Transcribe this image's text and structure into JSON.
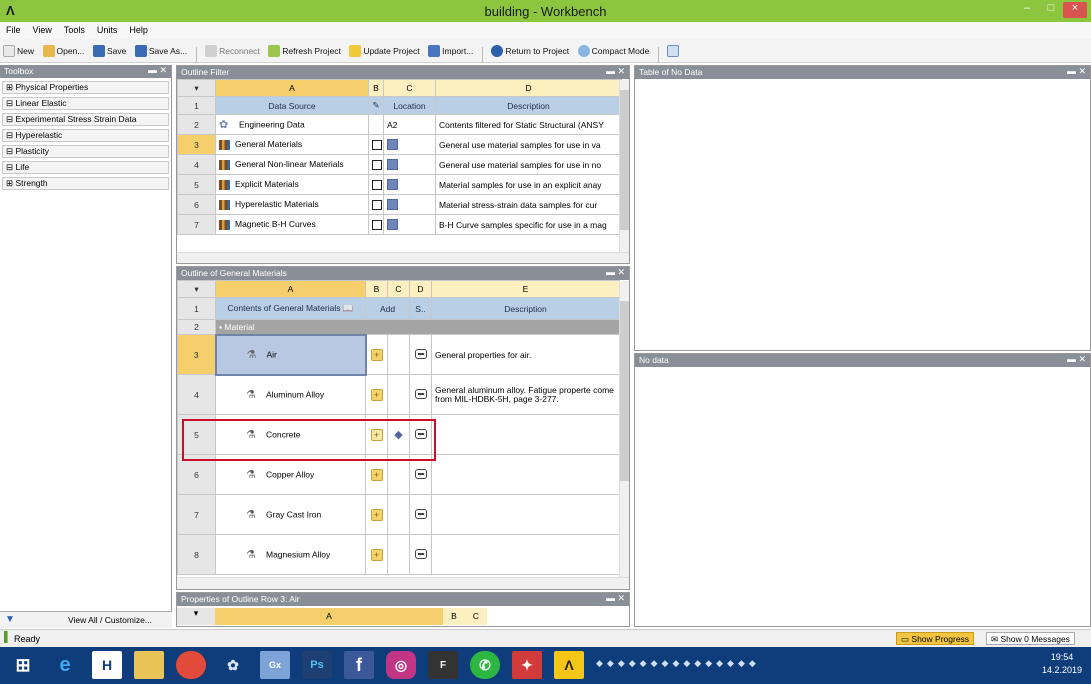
{
  "window": {
    "title": "building - Workbench",
    "logo": "Λ",
    "min": "–",
    "max": "□",
    "close": "×"
  },
  "menu": [
    "File",
    "View",
    "Tools",
    "Units",
    "Help"
  ],
  "toolbar": {
    "new": "New",
    "open": "Open...",
    "save": "Save",
    "save_as": "Save As...",
    "reconnect": "Reconnect",
    "refresh": "Refresh Project",
    "update": "Update Project",
    "import": "Import...",
    "return": "Return to Project",
    "compact": "Compact Mode"
  },
  "toolbox": {
    "title": "Toolbox",
    "items": [
      "Physical Properties",
      "Linear Elastic",
      "Experimental Stress Strain Data",
      "Hyperelastic",
      "Plasticity",
      "Life",
      "Strength"
    ],
    "footer": "View All / Customize..."
  },
  "outline_filter": {
    "title": "Outline Filter",
    "cols": [
      "A",
      "B",
      "C",
      "D"
    ],
    "headers": [
      "Data Source",
      "Location",
      "Description"
    ],
    "rows": [
      {
        "n": "2",
        "name": "Engineering Data",
        "loc": "A2",
        "desc": "Contents filtered for Static Structural (ANSY"
      },
      {
        "n": "3",
        "name": "General Materials",
        "loc": "",
        "desc": "General use material samples for use in va"
      },
      {
        "n": "4",
        "name": "General Non-linear Materials",
        "loc": "",
        "desc": "General use material samples for use in no"
      },
      {
        "n": "5",
        "name": "Explicit Materials",
        "loc": "",
        "desc": "Material samples for use in an explicit anay"
      },
      {
        "n": "6",
        "name": "Hyperelastic Materials",
        "loc": "",
        "desc": "Material stress-strain data samples for cur"
      },
      {
        "n": "7",
        "name": "Magnetic B-H Curves",
        "loc": "",
        "desc": "B-H Curve samples specific for use in a mag"
      }
    ]
  },
  "outline_general": {
    "title": "Outline of General Materials",
    "cols": [
      "A",
      "B",
      "C",
      "D",
      "E"
    ],
    "header_contents": "Contents of General Materials",
    "header_add": "Add",
    "header_s": "S..",
    "header_desc": "Description",
    "section": "Material",
    "rows": [
      {
        "n": "3",
        "name": "Air",
        "desc": "General properties for air."
      },
      {
        "n": "4",
        "name": "Aluminum Alloy",
        "desc": "General aluminum alloy. Fatigue properte come from MIL-HDBK-5H, page 3-277."
      },
      {
        "n": "5",
        "name": "Concrete",
        "desc": ""
      },
      {
        "n": "6",
        "name": "Copper Alloy",
        "desc": ""
      },
      {
        "n": "7",
        "name": "Gray Cast Iron",
        "desc": ""
      },
      {
        "n": "8",
        "name": "Magnesium Alloy",
        "desc": ""
      }
    ]
  },
  "properties": {
    "title": "Properties of Outline Row 3: Air",
    "col_a": "A",
    "col_b": "B",
    "col_c": "C"
  },
  "table_panel": {
    "title": "Table of No Data"
  },
  "chart_panel": {
    "title": "No data"
  },
  "status": {
    "ready": "Ready",
    "show_progress": "Show Progress",
    "show_messages": "Show 0 Messages"
  },
  "clock": {
    "time": "19:54",
    "date": "14.2.2019"
  },
  "colors": {
    "accent": "#8cc63f",
    "selection": "#c8102e",
    "taskbar": "#0f3c7a"
  }
}
